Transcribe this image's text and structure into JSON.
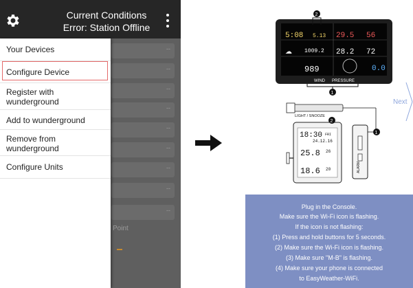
{
  "app": {
    "title": "Current Conditions",
    "subtitle": "Error: Station Offline"
  },
  "icons": {
    "settings": "gear-icon",
    "more": "more-vert-icon",
    "arrow": "right-arrow-icon",
    "next": "chevron-right-icon",
    "wifi": "wifi-icon"
  },
  "drawer": {
    "items": [
      {
        "label": "Your Devices"
      },
      {
        "label": "Configure Device",
        "selected": true
      },
      {
        "label": "Register with wunderground"
      },
      {
        "label": "Add to wunderground"
      },
      {
        "label": "Remove from wunderground"
      },
      {
        "label": "Configure Units"
      }
    ]
  },
  "background": {
    "row_value": "--",
    "point_label": "Point"
  },
  "diagram": {
    "marker_numbers": [
      "1",
      "2"
    ],
    "console": {
      "time": "5:08",
      "date": "5.13",
      "temp_out": "29.5",
      "hum_out": "56",
      "pressure_in": "1009.2",
      "temp_in": "28.2",
      "hum_in": "72",
      "rain_value": "989",
      "wind_value": "0.0",
      "wind_label": "WIND",
      "pressure_label": "PRESSURE"
    },
    "sensor": {
      "button_label": "LIGHT / SNOOZE",
      "time": "18:30",
      "day": "FRI",
      "date": "24.12.16",
      "temp1": "25.8",
      "hum1": "26",
      "temp2": "18.6",
      "hum2": "20",
      "side_label": "ALARM"
    },
    "next_label": "Next"
  },
  "instructions": {
    "lines": [
      "Plug in the Console.",
      "Make sure the Wi-Fi icon is flashing.",
      "If the icon is not flashing:",
      "(1) Press and hold buttons for 5 seconds.",
      "(2) Make sure the Wi-Fi icon is flashing.",
      "(3) Make sure \"M-B\" is flashing.",
      "(4) Make sure your phone is connected",
      "to EasyWeather-WiFi."
    ]
  },
  "colors": {
    "header_bg": "#262626",
    "selected_border": "#e46a6a",
    "instruction_bg": "#7e8fc3",
    "next_color": "#8fa7dd"
  }
}
